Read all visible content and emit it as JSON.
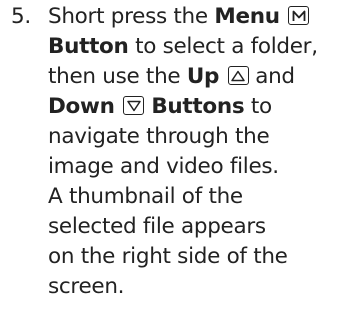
{
  "step": {
    "number": "5.",
    "line1": {
      "t1": "Short press the ",
      "b1": "Menu",
      "icon1": "menu-m-icon"
    },
    "line2": {
      "b1": "Button",
      "t1": " to select a folder,"
    },
    "line3": {
      "t1": "then use the ",
      "b1": "Up",
      "icon1": "up-triangle-icon",
      "t2": " and"
    },
    "line4": {
      "b1": "Down",
      "icon1": "down-triangle-icon",
      "b2": " Buttons",
      "t1": " to"
    },
    "line5": "navigate through the",
    "line6": "image and video files.",
    "line7": "A thumbnail of the",
    "line8": "selected file appears",
    "line9": "on the right side of the",
    "line10": "screen."
  }
}
